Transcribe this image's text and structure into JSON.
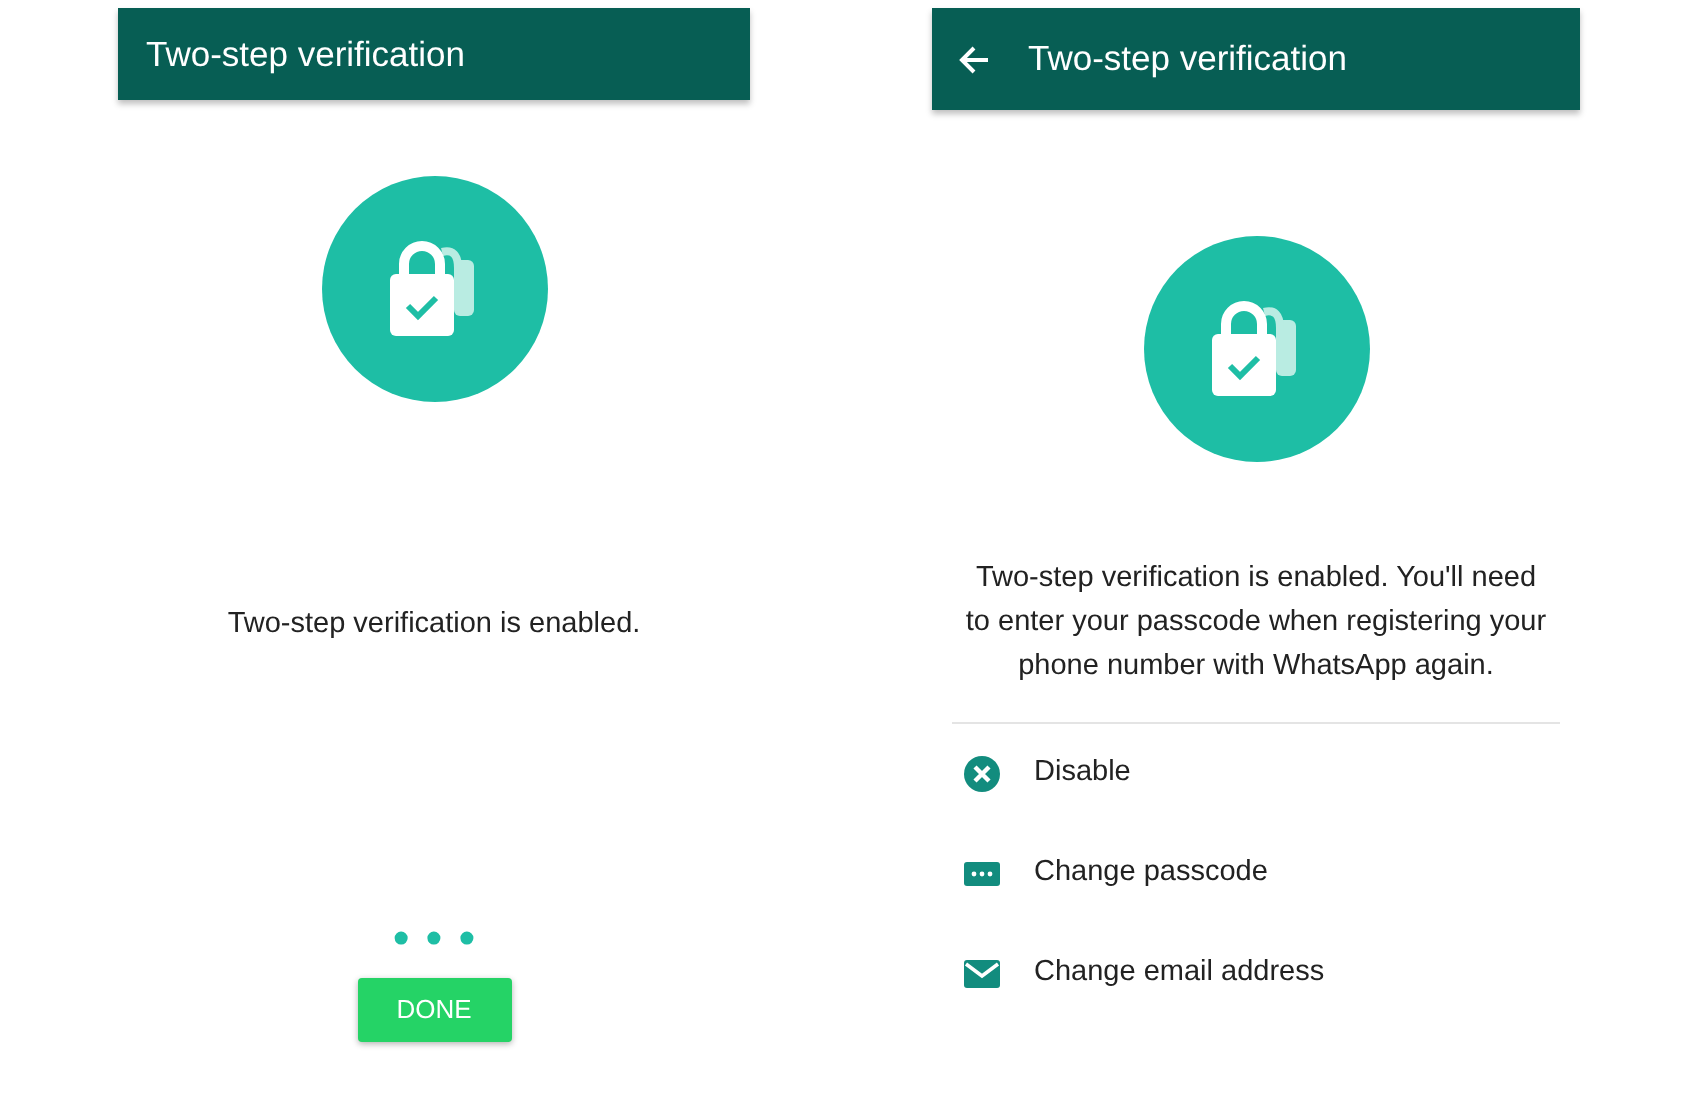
{
  "screens": [
    {
      "title": "Two-step verification",
      "back_button": false,
      "message": "Two-step verification is enabled.",
      "dots": [
        "•",
        "•",
        "•"
      ],
      "button": "DONE"
    },
    {
      "title": "Two-step verification",
      "back_button": true,
      "message": "Two-step verification is enabled. You'll need to enter your passcode when registering your phone number with WhatsApp again.",
      "options": [
        {
          "kind": "disable",
          "label": "Disable"
        },
        {
          "kind": "passcode",
          "label": "Change passcode"
        },
        {
          "kind": "email",
          "label": "Change email address"
        }
      ]
    }
  ]
}
